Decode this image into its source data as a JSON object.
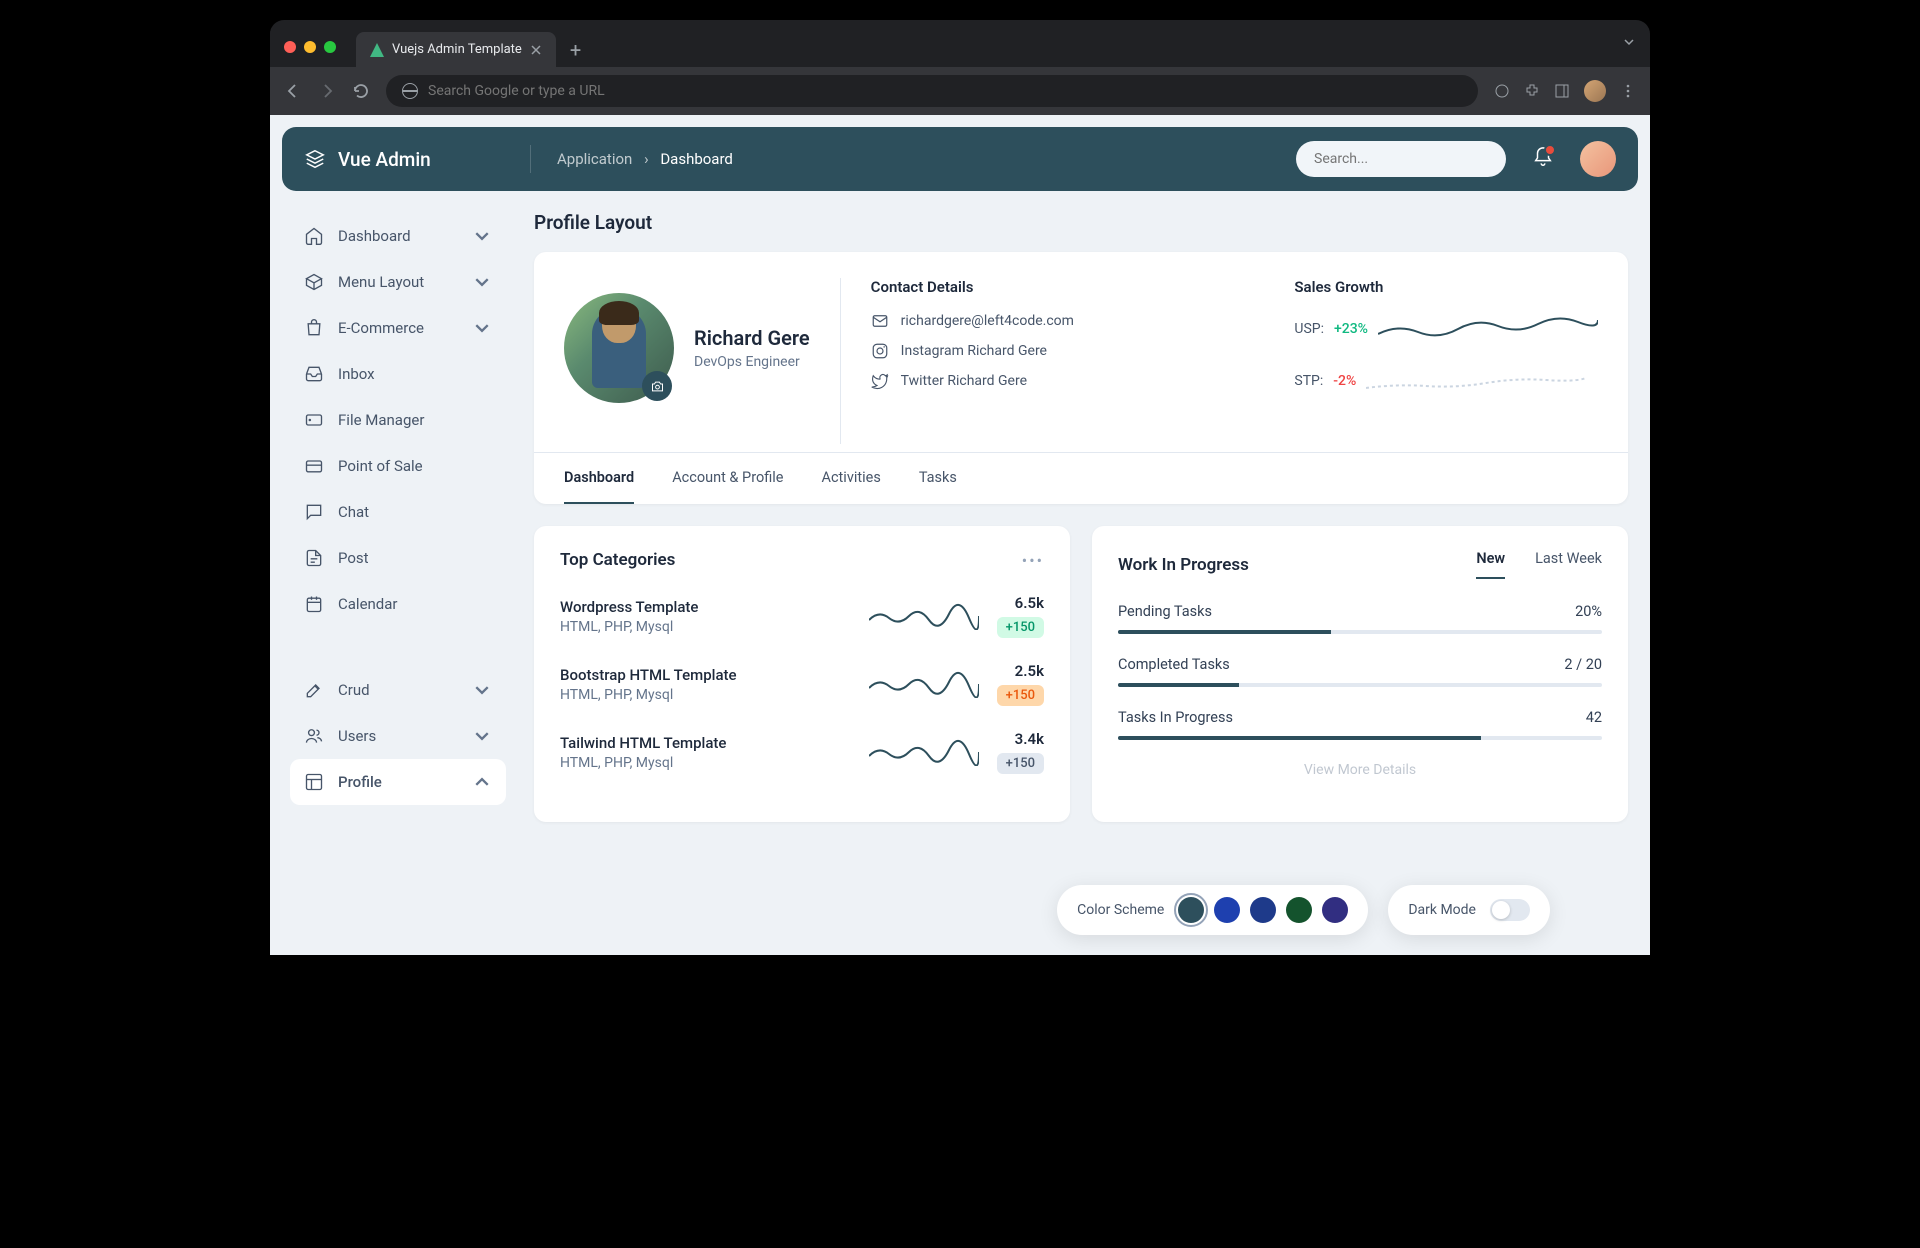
{
  "browser": {
    "tab_title": "Vuejs Admin Template",
    "url_placeholder": "Search Google or type a URL"
  },
  "appbar": {
    "brand": "Vue Admin",
    "crumb_root": "Application",
    "crumb_current": "Dashboard",
    "search_placeholder": "Search..."
  },
  "sidebar": {
    "items": [
      {
        "label": "Dashboard",
        "icon": "home",
        "chev": true
      },
      {
        "label": "Menu Layout",
        "icon": "box",
        "chev": true
      },
      {
        "label": "E-Commerce",
        "icon": "bag",
        "chev": true
      },
      {
        "label": "Inbox",
        "icon": "inbox",
        "chev": false
      },
      {
        "label": "File Manager",
        "icon": "drive",
        "chev": false
      },
      {
        "label": "Point of Sale",
        "icon": "card",
        "chev": false
      },
      {
        "label": "Chat",
        "icon": "chat",
        "chev": false
      },
      {
        "label": "Post",
        "icon": "file",
        "chev": false
      },
      {
        "label": "Calendar",
        "icon": "calendar",
        "chev": false
      }
    ],
    "group2": [
      {
        "label": "Crud",
        "icon": "edit",
        "chev": true
      },
      {
        "label": "Users",
        "icon": "users",
        "chev": true
      },
      {
        "label": "Profile",
        "icon": "layout",
        "chev": true,
        "active": true
      }
    ]
  },
  "page_title": "Profile Layout",
  "profile": {
    "name": "Richard Gere",
    "role": "DevOps Engineer",
    "contact_title": "Contact Details",
    "contacts": {
      "email": "richardgere@left4code.com",
      "instagram": "Instagram Richard Gere",
      "twitter": "Twitter Richard Gere"
    },
    "growth_title": "Sales Growth",
    "usp_label": "USP:",
    "usp_value": "+23%",
    "stp_label": "STP:",
    "stp_value": "-2%"
  },
  "profile_tabs": [
    "Dashboard",
    "Account & Profile",
    "Activities",
    "Tasks"
  ],
  "top_categories": {
    "title": "Top Categories",
    "items": [
      {
        "title": "Wordpress Template",
        "sub": "HTML, PHP, Mysql",
        "value": "6.5k",
        "delta": "+150",
        "badge": "g"
      },
      {
        "title": "Bootstrap HTML Template",
        "sub": "HTML, PHP, Mysql",
        "value": "2.5k",
        "delta": "+150",
        "badge": "o"
      },
      {
        "title": "Tailwind HTML Template",
        "sub": "HTML, PHP, Mysql",
        "value": "3.4k",
        "delta": "+150",
        "badge": "gr"
      }
    ]
  },
  "wip": {
    "title": "Work In Progress",
    "tab_new": "New",
    "tab_last": "Last Week",
    "rows": [
      {
        "label": "Pending Tasks",
        "value": "20%",
        "pct": 44
      },
      {
        "label": "Completed Tasks",
        "value": "2 / 20",
        "pct": 25
      },
      {
        "label": "Tasks In Progress",
        "value": "42",
        "pct": 75
      }
    ],
    "view_more": "View More Details"
  },
  "scheme": {
    "label": "Color Scheme",
    "colors": [
      "#2d4f5c",
      "#1e40af",
      "#1e3a8a",
      "#14532d",
      "#312e81"
    ],
    "dark_label": "Dark Mode"
  }
}
